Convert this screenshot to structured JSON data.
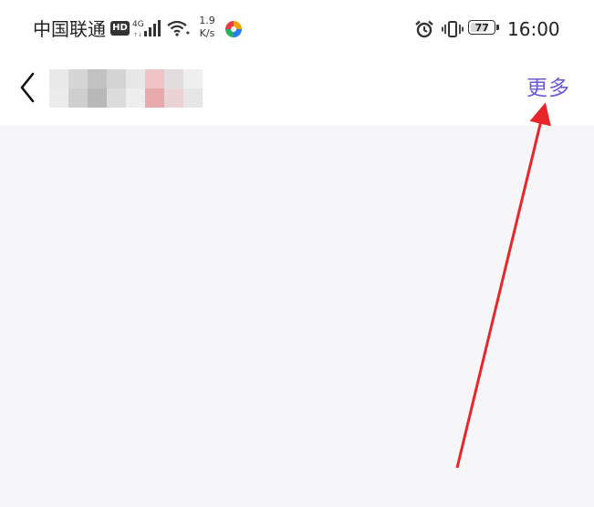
{
  "status_bar": {
    "carrier": "中国联通",
    "hd_badge": "HD",
    "network_type": "4G",
    "net_speed_value": "1.9",
    "net_speed_unit": "K/s",
    "icons": [
      "hd-icon",
      "signal-icon",
      "wifi-icon",
      "app-icon",
      "alarm-icon",
      "vibrate-icon",
      "battery-icon"
    ],
    "battery_level": "77",
    "time": "16:00"
  },
  "nav_bar": {
    "back_icon": "chevron-left-icon",
    "more_label": "更多",
    "more_color": "#6a5bd6"
  },
  "annotation": {
    "arrow_color": "#e8262a",
    "points_to": "more-button"
  }
}
